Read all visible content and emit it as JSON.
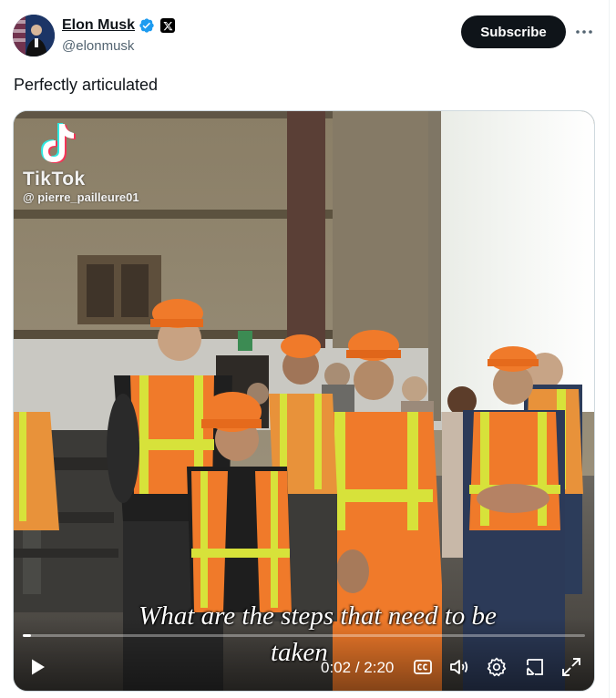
{
  "author": {
    "display_name": "Elon Musk",
    "handle": "@elonmusk",
    "verified_icon": "verified-badge-icon",
    "affiliation_icon": "x-logo-icon"
  },
  "header": {
    "subscribe_label": "Subscribe",
    "more_icon": "more-horizontal-icon"
  },
  "tweet": {
    "text": "Perfectly articulated"
  },
  "video": {
    "watermark": {
      "brand": "TikTok",
      "username": "@ pierre_pailleure01"
    },
    "caption_line1": "What are the steps that need to be",
    "caption_line2": "taken",
    "current_time": "0:02",
    "duration": "2:20",
    "time_display": "0:02 / 2:20",
    "progress_fraction": 0.015,
    "controls": [
      "play-icon",
      "captions-icon",
      "volume-icon",
      "settings-icon",
      "picture-in-picture-icon",
      "fullscreen-icon"
    ]
  },
  "colors": {
    "accent_blue": "#1d9bf0",
    "text_primary": "#0f1419",
    "text_secondary": "#536471",
    "safety_orange": "#f07a2a",
    "safety_yellow": "#d7e23a"
  }
}
